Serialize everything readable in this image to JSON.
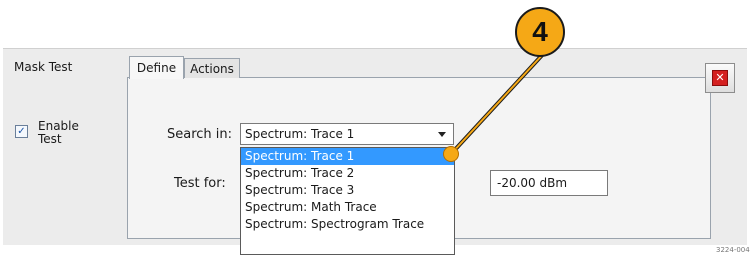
{
  "section": {
    "title": "Mask Test"
  },
  "enable": {
    "label_line1": "Enable",
    "label_line2": "Test",
    "checked": true,
    "check_mark": "✓"
  },
  "tabs": [
    {
      "label": "Define",
      "active": true
    },
    {
      "label": "Actions",
      "active": false
    }
  ],
  "close_button": {
    "icon": "close-icon",
    "glyph": "✕"
  },
  "search": {
    "label": "Search in:",
    "selected": "Spectrum: Trace 1",
    "options": [
      "Spectrum: Trace 1",
      "Spectrum: Trace 2",
      "Spectrum: Trace 3",
      "Spectrum: Math Trace",
      "Spectrum: Spectrogram Trace"
    ]
  },
  "test_for": {
    "label": "Test for:",
    "value": "-20.00 dBm"
  },
  "callout": {
    "number": "4",
    "color": "#f5a816"
  },
  "figure_id": "3224-004"
}
